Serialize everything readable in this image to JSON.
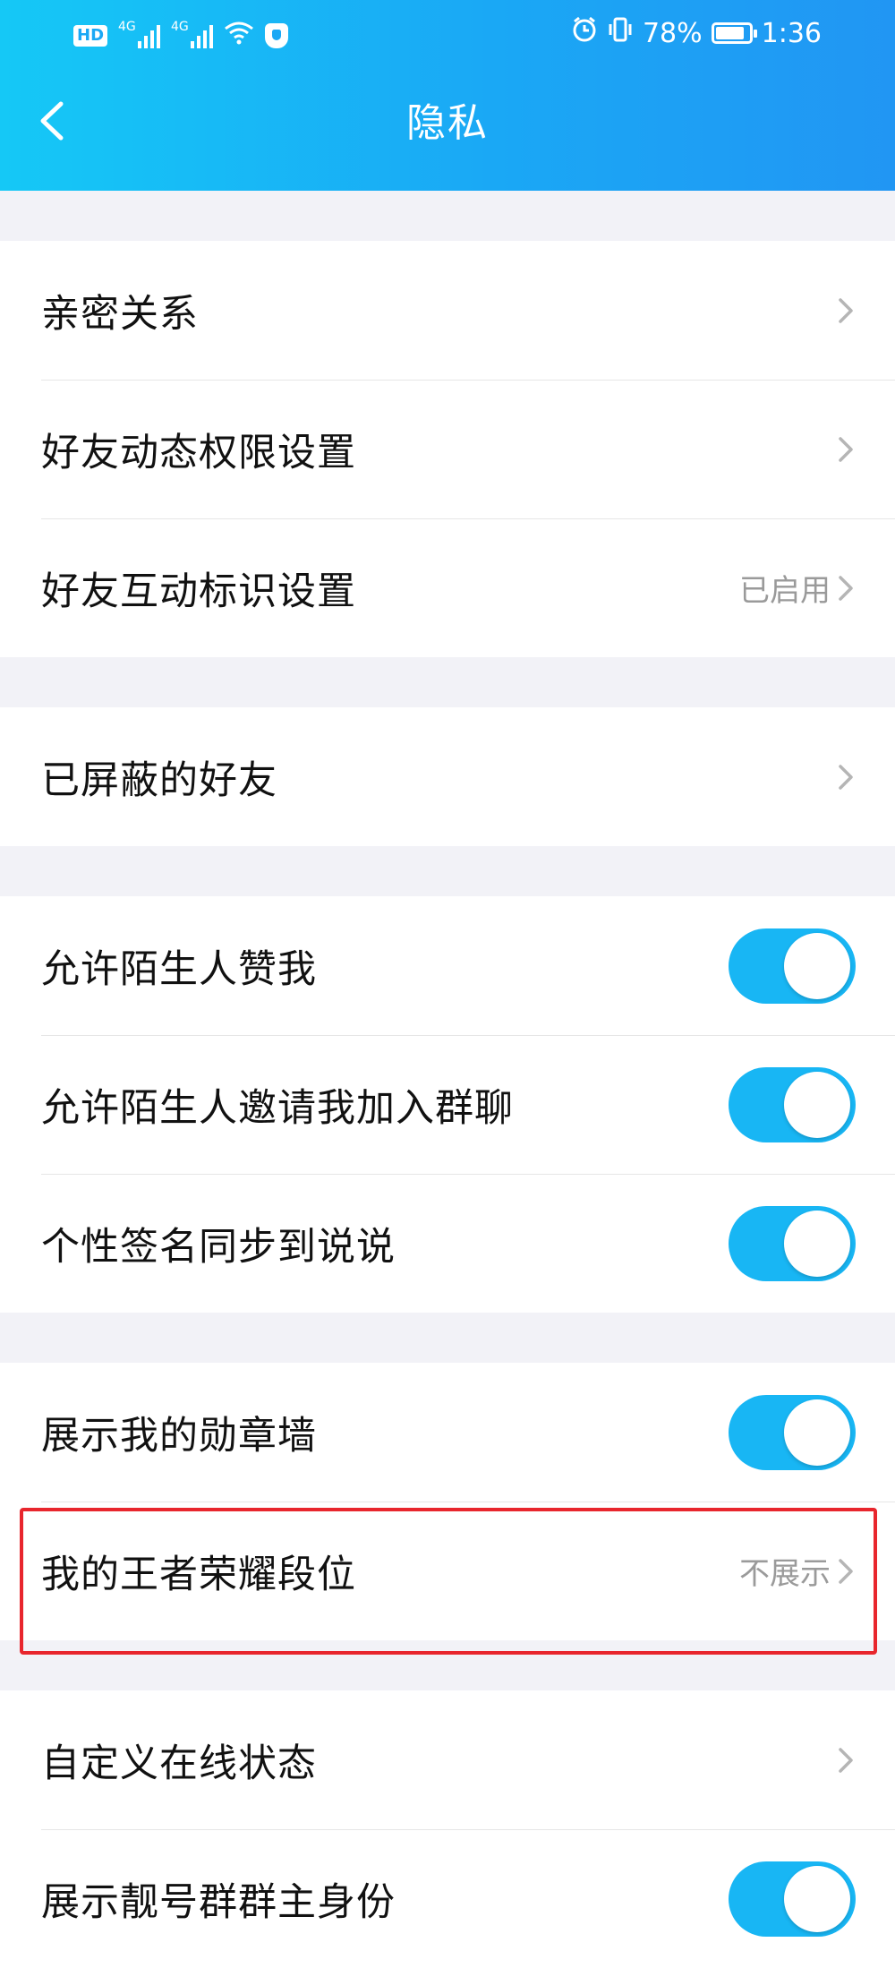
{
  "status_bar": {
    "hd": "HD",
    "net1": "4G",
    "net2": "4G",
    "battery": "78%",
    "time": "1:36"
  },
  "header": {
    "title": "隐私"
  },
  "groups": [
    [
      {
        "label": "亲密关系",
        "type": "link",
        "value": ""
      },
      {
        "label": "好友动态权限设置",
        "type": "link",
        "value": ""
      },
      {
        "label": "好友互动标识设置",
        "type": "link",
        "value": "已启用"
      }
    ],
    [
      {
        "label": "已屏蔽的好友",
        "type": "link",
        "value": ""
      }
    ],
    [
      {
        "label": "允许陌生人赞我",
        "type": "toggle",
        "on": true
      },
      {
        "label": "允许陌生人邀请我加入群聊",
        "type": "toggle",
        "on": true
      },
      {
        "label": "个性签名同步到说说",
        "type": "toggle",
        "on": true
      }
    ],
    [
      {
        "label": "展示我的勋章墙",
        "type": "toggle",
        "on": true
      },
      {
        "label": "我的王者荣耀段位",
        "type": "link",
        "value": "不展示"
      }
    ],
    [
      {
        "label": "自定义在线状态",
        "type": "link",
        "value": ""
      },
      {
        "label": "展示靓号群群主身份",
        "type": "toggle",
        "on": true
      }
    ]
  ],
  "colors": {
    "accent": "#18b6f4",
    "highlight": "#e8262d"
  }
}
